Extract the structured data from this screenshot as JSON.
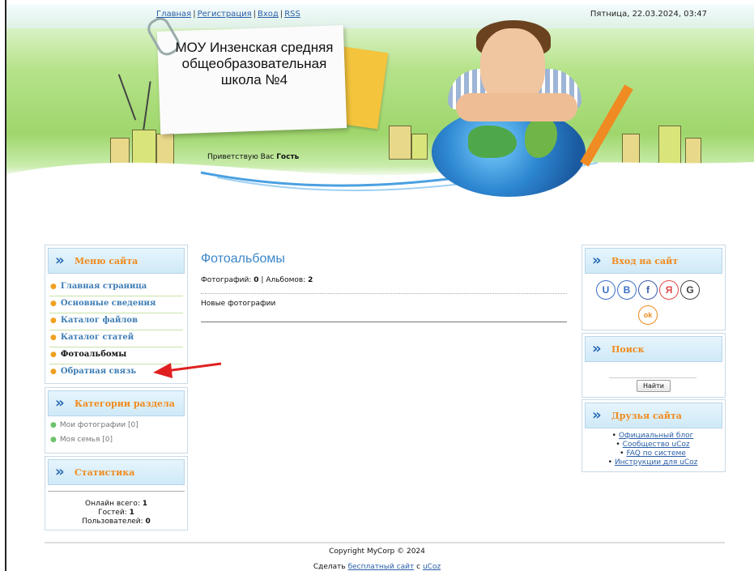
{
  "header": {
    "top_links": [
      "Главная",
      "Регистрация",
      "Вход",
      "RSS"
    ],
    "separator": "|",
    "date": "Пятница, 22.03.2024, 03:47",
    "site_title": "МОУ Инзенская средняя общеобразовательная школа №4",
    "greeting_prefix": "Приветствую Вас",
    "greeting_user": "Гость"
  },
  "left": {
    "menu_title": "Меню сайта",
    "menu_items": [
      "Главная страница",
      "Основные сведения",
      "Каталог файлов",
      "Каталог статей",
      "Фотоальбомы",
      "Обратная связь"
    ],
    "categories_title": "Категории раздела",
    "categories": [
      {
        "name": "Мои фотографии",
        "count": "[0]"
      },
      {
        "name": "Моя семья",
        "count": "[0]"
      }
    ],
    "stats_title": "Статистика",
    "stats": {
      "online_label": "Онлайн всего:",
      "online_value": "1",
      "guests_label": "Гостей:",
      "guests_value": "1",
      "users_label": "Пользователей:",
      "users_value": "0"
    }
  },
  "main": {
    "title": "Фотоальбомы",
    "photos_label": "Фотографий:",
    "photos_value": "0",
    "stats_sep": "|",
    "albums_label": "Альбомов:",
    "albums_value": "2",
    "new_photos": "Новые фотографии"
  },
  "right": {
    "login_title": "Вход на сайт",
    "social": [
      {
        "glyph": "U",
        "color": "#3b6fc6",
        "icon": "ucoz-icon"
      },
      {
        "glyph": "В",
        "color": "#3b6fc6",
        "icon": "vk-icon"
      },
      {
        "glyph": "f",
        "color": "#3b5ba8",
        "icon": "facebook-icon"
      },
      {
        "glyph": "Я",
        "color": "#e04848",
        "icon": "yandex-icon"
      },
      {
        "glyph": "G",
        "color": "#444444",
        "icon": "google-icon"
      },
      {
        "glyph": "ok",
        "color": "#f08a1c",
        "icon": "odnoklassniki-icon"
      }
    ],
    "search_title": "Поиск",
    "search_button": "Найти",
    "friends_title": "Друзья сайта",
    "friends": [
      "Официальный блог",
      "Сообщество uCoz",
      "FAQ по системе",
      "Инструкции для uCoz"
    ]
  },
  "footer": {
    "copyright": "Copyright MyCorp © 2024",
    "make_prefix": "Сделать",
    "make_link": "бесплатный сайт",
    "make_mid": "с",
    "make_brand": "uCoz"
  },
  "colors": {
    "accent_orange": "#f08a1c",
    "link_blue": "#2a5fa8",
    "title_blue": "#3b86c9",
    "arrow_red": "#e02020"
  }
}
